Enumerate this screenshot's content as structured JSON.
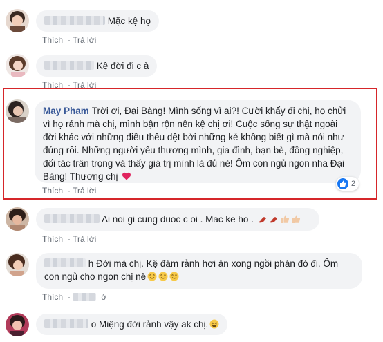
{
  "actions": {
    "like": "Thích",
    "reply": "Trả lời"
  },
  "comments": [
    {
      "text": "Mặc kệ họ"
    },
    {
      "text": "Kệ đời đi c à"
    },
    {
      "name": "May Pham",
      "text": "Trời ơi, Đại Bàng! Mình sống vì ai?! Cười khẩy đi chị, họ chửi vì họ rảnh mà chị, mình bận rộn nên kệ chị ơi! Cuộc sống sự thật ngoài đời khác với những điều thêu dệt bởi những kẻ không biết gì mà nói như đúng rồi. Những người yêu thương mình, gia đình, bạn bè, đồng nghiệp, đối tác trân trọng và thấy giá trị mình là đủ nè! Ôm con ngủ ngon nha Đại Bàng! Thương chị",
      "reactions": "2"
    },
    {
      "text": "Ai noi gi cung duoc c oi . Mac ke ho ."
    },
    {
      "text": "h Đời mà chị. Kệ đám rảnh hơi ăn xong ngồi phán đó đi. Ôm con ngủ cho ngon chị nè"
    },
    {
      "text": "o Miệng đời rảnh vậy ak chị."
    }
  ],
  "partial_reply": "ờ",
  "highlight_color": "#d6262a",
  "link_color": "#385898"
}
